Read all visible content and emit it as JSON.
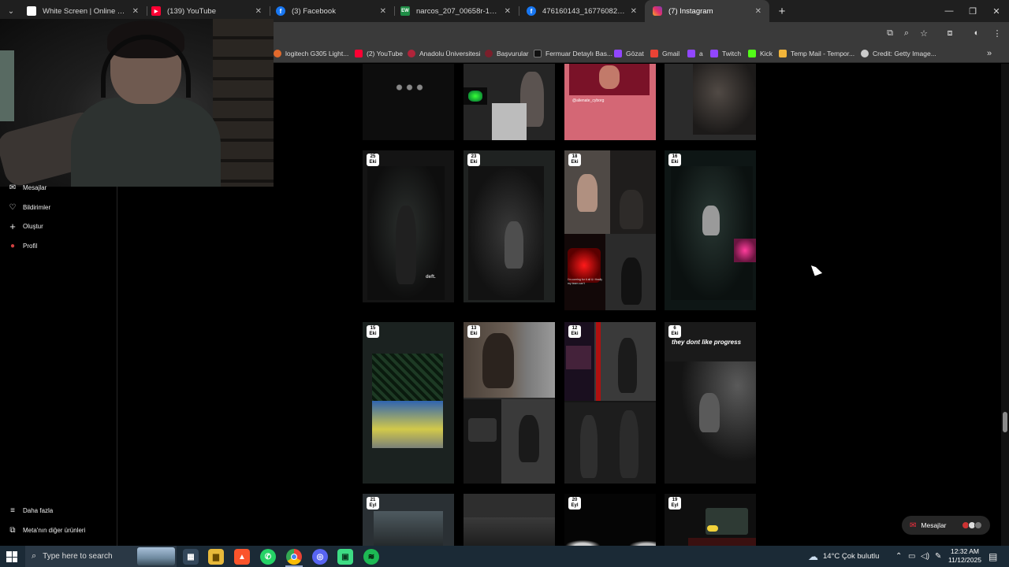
{
  "browser": {
    "tabs": [
      {
        "label": "White Screen | Online Tool",
        "icon": "whitescreen-favicon",
        "color": "#ffffff",
        "active": false
      },
      {
        "label": "(139) YouTube",
        "icon": "youtube-favicon",
        "color": "#ff0033",
        "active": false
      },
      {
        "label": "(3) Facebook",
        "icon": "facebook-favicon",
        "color": "#1877f2",
        "active": false
      },
      {
        "label": "narcos_207_00658r-1-a753b45...",
        "icon": "ew-favicon",
        "color": "#1e8c45",
        "active": false
      },
      {
        "label": "476160143_167760827952017...",
        "icon": "facebook-favicon",
        "color": "#1877f2",
        "active": false
      },
      {
        "label": "(7) Instagram",
        "icon": "instagram-favicon",
        "color": "#e1306c",
        "active": true
      }
    ],
    "new_tab_symbol": "+",
    "window_controls": {
      "minimize": "—",
      "restore": "❐",
      "close": "✕"
    },
    "bookmarks": [
      {
        "label": "logitech G305 Light...",
        "color": "#e26a2c"
      },
      {
        "label": "(2) YouTube",
        "color": "#ff0033"
      },
      {
        "label": "Anadolu Üniversitesi",
        "color": "#b0243a"
      },
      {
        "label": "Başvurular",
        "color": "#7a1f2b"
      },
      {
        "label": "Fermuar Detaylı Bas...",
        "color": "#111111"
      },
      {
        "label": "Gözat",
        "color": "#9146ff"
      },
      {
        "label": "Gmail",
        "color": "#ea4335"
      },
      {
        "label": "a",
        "color": "#9146ff"
      },
      {
        "label": "Twitch",
        "color": "#9146ff"
      },
      {
        "label": "Kick",
        "color": "#53fc18"
      },
      {
        "label": "Temp Mail - Tempor...",
        "color": "#f2b53a"
      },
      {
        "label": "Credit: Getty Image...",
        "color": "#cccccc"
      }
    ],
    "bookmarks_more": "»"
  },
  "sidebar": {
    "items_top": [
      {
        "label": "Mesajlar",
        "icon": "messages-icon",
        "glyph": "✉"
      },
      {
        "label": "Bildirimler",
        "icon": "heart-icon",
        "glyph": "♡"
      },
      {
        "label": "Oluştur",
        "icon": "plus-icon",
        "glyph": "+"
      },
      {
        "label": "Profil",
        "icon": "profile-avatar-icon",
        "glyph": "●"
      }
    ],
    "items_bottom": [
      {
        "label": "Daha fazla",
        "icon": "hamburger-menu-icon",
        "glyph": "≡"
      },
      {
        "label": "Meta'nın diğer ürünleri",
        "icon": "meta-products-icon",
        "glyph": "⧉"
      }
    ]
  },
  "grid": {
    "row0": [
      {
        "day": "",
        "month": ""
      },
      {
        "day": "",
        "month": ""
      },
      {
        "day": "",
        "month": "",
        "caption": "@alienate_cyborg"
      },
      {
        "day": "",
        "month": ""
      }
    ],
    "row1": [
      {
        "day": "25",
        "month": "Eki",
        "watermark": "deft."
      },
      {
        "day": "23",
        "month": "Eki"
      },
      {
        "day": "18",
        "month": "Eki",
        "caption": "I'm coming for it all & i finally my team can't"
      },
      {
        "day": "16",
        "month": "Eki"
      }
    ],
    "row2": [
      {
        "day": "15",
        "month": "Eki"
      },
      {
        "day": "13",
        "month": "Eki"
      },
      {
        "day": "12",
        "month": "Eki"
      },
      {
        "day": "6",
        "month": "Eki",
        "overlay": "they dont like progress"
      }
    ],
    "row3": [
      {
        "day": "21",
        "month": "Eyl"
      },
      {
        "day": "",
        "month": ""
      },
      {
        "day": "20",
        "month": "Eyl"
      },
      {
        "day": "19",
        "month": "Eyl"
      }
    ]
  },
  "messages_pill": {
    "label": "Mesajlar"
  },
  "taskbar": {
    "search_placeholder": "Type here to search",
    "apps": [
      {
        "name": "file-explorer-icon",
        "color": "#e8b93a",
        "glyph": "▆"
      },
      {
        "name": "brave-icon",
        "color": "#fb542b",
        "glyph": "▲"
      },
      {
        "name": "whatsapp-icon",
        "color": "#25d366",
        "glyph": "✆"
      },
      {
        "name": "chrome-icon",
        "color": "#4285f4",
        "glyph": "◉"
      },
      {
        "name": "discord-icon",
        "color": "#5865f2",
        "glyph": "◎"
      },
      {
        "name": "android-studio-icon",
        "color": "#3ddc84",
        "glyph": "▣"
      },
      {
        "name": "spotify-icon",
        "color": "#1db954",
        "glyph": "≋"
      }
    ],
    "weather": "14°C  Çok bulutlu",
    "time": "12:32 AM",
    "date": "11/12/2025"
  }
}
